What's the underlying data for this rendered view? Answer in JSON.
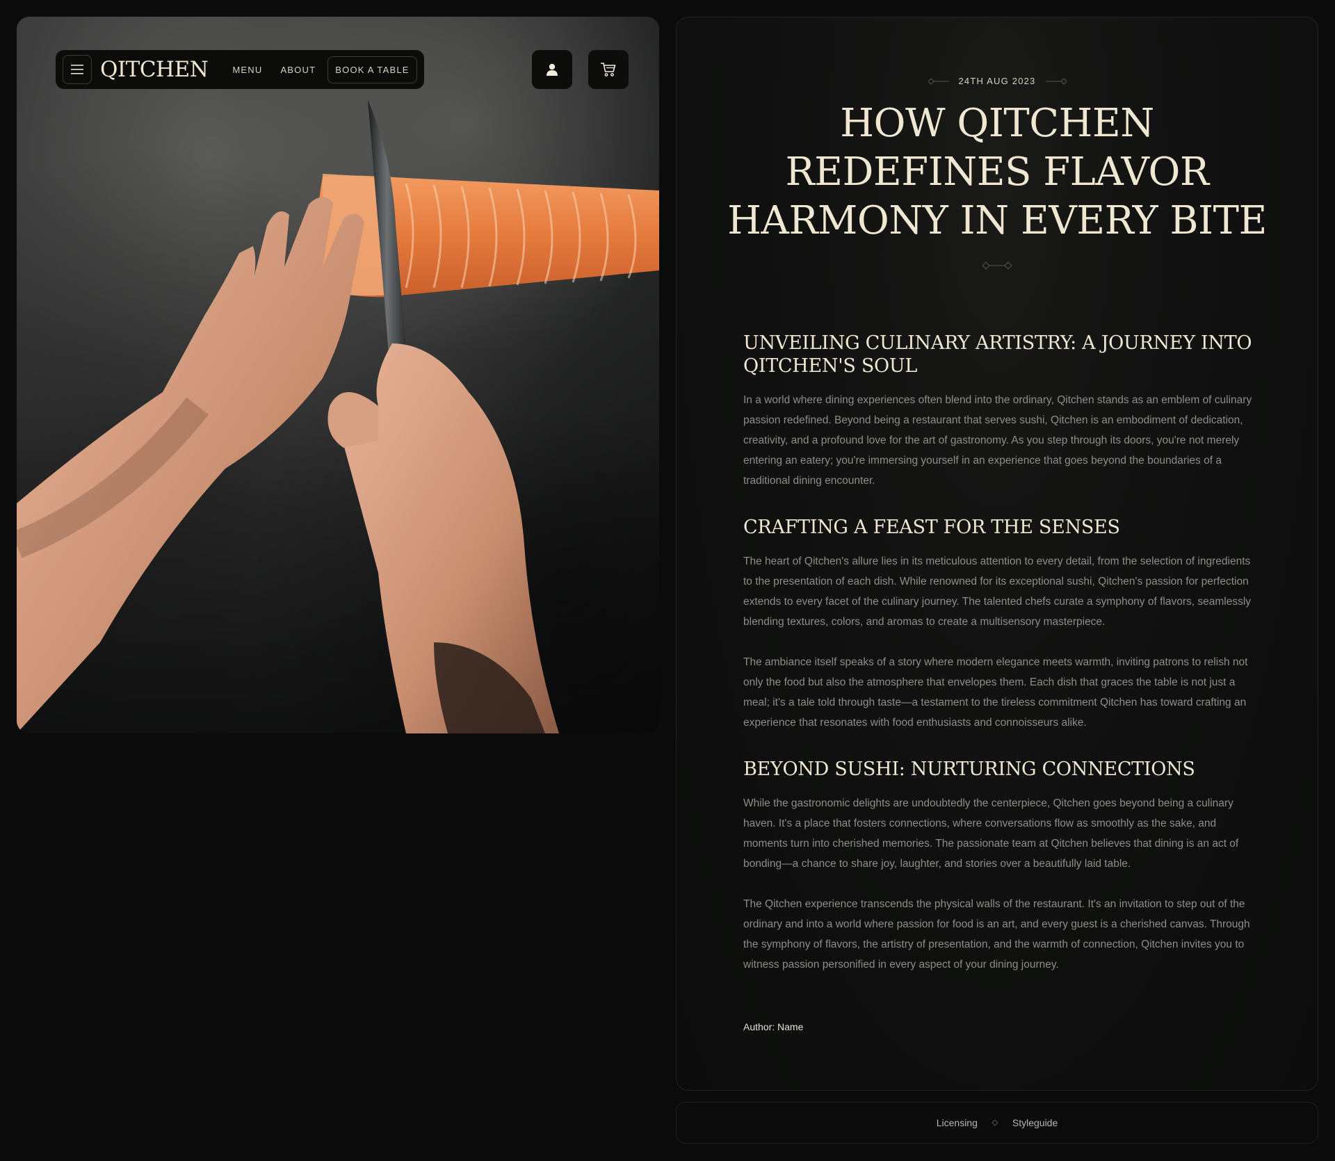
{
  "nav": {
    "logo": "QITCHEN",
    "links": [
      "MENU",
      "ABOUT",
      "BOOK A TABLE"
    ],
    "icons": [
      "hamburger-menu-icon",
      "user-icon",
      "cart-icon"
    ]
  },
  "article": {
    "date": "24TH AUG 2023",
    "title": "HOW QITCHEN REDEFINES FLAVOR HARMONY IN EVERY BITE",
    "sections": [
      {
        "heading": "UNVEILING CULINARY ARTISTRY: A JOURNEY INTO QITCHEN'S SOUL",
        "paragraphs": [
          "In a world where dining experiences often blend into the ordinary, Qitchen stands as an emblem of culinary passion redefined. Beyond being a restaurant that serves sushi, Qitchen is an embodiment of dedication, creativity, and a profound love for the art of gastronomy. As you step through its doors, you're not merely entering an eatery; you're immersing yourself in an experience that goes beyond the boundaries of a traditional dining encounter."
        ]
      },
      {
        "heading": "CRAFTING A FEAST FOR THE SENSES",
        "paragraphs": [
          "The heart of Qitchen's allure lies in its meticulous attention to every detail, from the selection of ingredients to the presentation of each dish. While renowned for its exceptional sushi, Qitchen's passion for perfection extends to every facet of the culinary journey. The talented chefs curate a symphony of flavors, seamlessly blending textures, colors, and aromas to create a multisensory masterpiece.",
          "The ambiance itself speaks of a story where modern elegance meets warmth, inviting patrons to relish not only the food but also the atmosphere that envelopes them. Each dish that graces the table is not just a meal; it's a tale told through taste—a testament to the tireless commitment Qitchen has toward crafting an experience that resonates with food enthusiasts and connoisseurs alike."
        ]
      },
      {
        "heading": "BEYOND SUSHI: NURTURING CONNECTIONS",
        "paragraphs": [
          "While the gastronomic delights are undoubtedly the centerpiece, Qitchen goes beyond being a culinary haven. It's a place that fosters connections, where conversations flow as smoothly as the sake, and moments turn into cherished memories. The passionate team at Qitchen believes that dining is an act of bonding—a chance to share joy, laughter, and stories over a beautifully laid table.",
          "The Qitchen experience transcends the physical walls of the restaurant. It's an invitation to step out of the ordinary and into a world where passion for food is an art, and every guest is a cherished canvas. Through the symphony of flavors, the artistry of presentation, and the warmth of connection, Qitchen invites you to witness passion personified in every aspect of your dining journey."
        ]
      }
    ],
    "author": "Author: Name"
  },
  "footer": {
    "links": [
      "Licensing",
      "Styleguide"
    ]
  },
  "colors": {
    "background": "#0a0b0a",
    "text_primary": "#efe7d2",
    "text_body": "#8f8d86",
    "salmon": "#e9804a"
  }
}
